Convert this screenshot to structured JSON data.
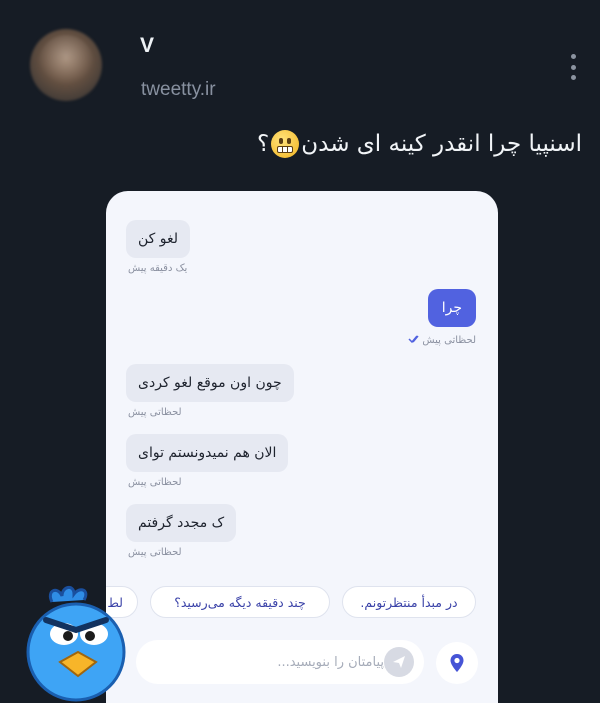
{
  "tweet": {
    "author_name": "V",
    "handle": "tweetty.ir",
    "text": "اسنپیا چرا انقدر کینه ای شدن",
    "text_end": "؟"
  },
  "icons": {
    "avatar": "blurred-profile-photo",
    "more": "vertical-dots-icon",
    "emoji": "grimacing-face-emoji",
    "read": "double-check-icon",
    "send": "send-arrow-icon",
    "location": "location-pin-icon",
    "sticker": "angry-blue-bird-sticker"
  },
  "chat": {
    "messages": [
      {
        "text": "لغو کن",
        "time": "یک دقیقه پیش",
        "direction": "in"
      },
      {
        "text": "چرا",
        "time": "لحظاتی پیش",
        "direction": "out"
      },
      {
        "text": "چون اون موقع لغو کردی",
        "time": "لحظاتی پیش",
        "direction": "in"
      },
      {
        "text": "الان هم نمیدونستم توای",
        "time": "لحظاتی پیش",
        "direction": "in"
      },
      {
        "text": "ک مجدد گرفتم",
        "time": "لحظاتی پیش",
        "direction": "in"
      }
    ],
    "quick_replies": [
      "در مبدأ منتظرتونم.",
      "چند دقیقه دیگه می‌رسید؟",
      "لط"
    ],
    "composer_placeholder": "پیامتان را بنویسید...",
    "colors": {
      "outgoing": "#5162e0",
      "incoming": "#e6e9f2",
      "quick_reply_text": "#3a42a8"
    }
  }
}
